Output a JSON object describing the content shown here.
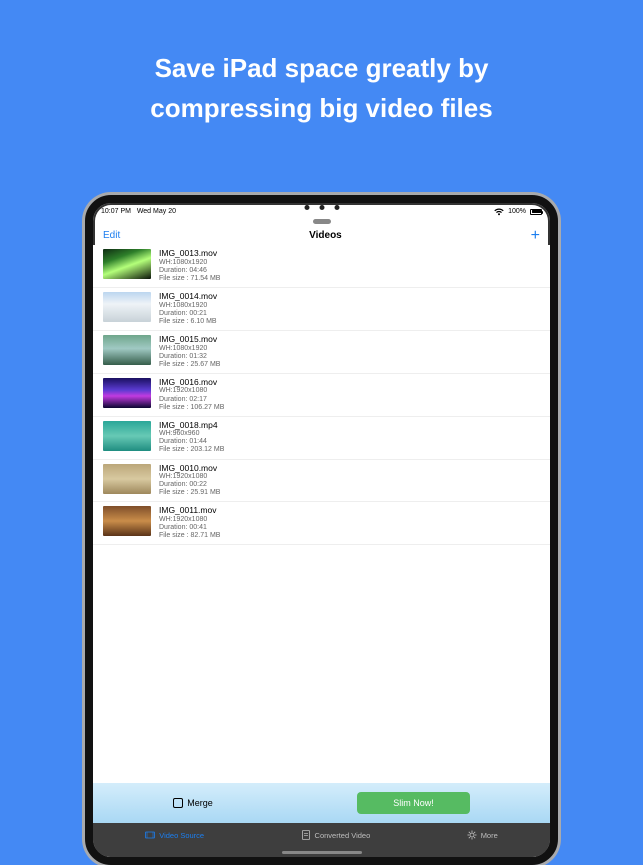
{
  "promo": {
    "line1": "Save iPad space  greatly by",
    "line2": "compressing big video files"
  },
  "statusbar": {
    "time": "10:07 PM",
    "date": "Wed May 20",
    "battery": "100%"
  },
  "nav": {
    "edit": "Edit",
    "title": "Videos",
    "add": "+"
  },
  "videos": [
    {
      "name": "IMG_0013.mov",
      "wh": "WH:1080x1920",
      "dur": "Duration: 04:46",
      "size": "File size : 71.54 MB",
      "t": "t0"
    },
    {
      "name": "IMG_0014.mov",
      "wh": "WH:1080x1920",
      "dur": "Duration: 00:21",
      "size": "File size : 6.10 MB",
      "t": "t1"
    },
    {
      "name": "IMG_0015.mov",
      "wh": "WH:1080x1920",
      "dur": "Duration: 01:32",
      "size": "File size : 25.67 MB",
      "t": "t2"
    },
    {
      "name": "IMG_0016.mov",
      "wh": "WH:1920x1080",
      "dur": "Duration: 02:17",
      "size": "File size : 106.27 MB",
      "t": "t3"
    },
    {
      "name": "IMG_0018.mp4",
      "wh": "WH:960x960",
      "dur": "Duration: 01:44",
      "size": "File size : 203.12 MB",
      "t": "t4"
    },
    {
      "name": "IMG_0010.mov",
      "wh": "WH:1920x1080",
      "dur": "Duration: 00:22",
      "size": "File size : 25.91 MB",
      "t": "t5"
    },
    {
      "name": "IMG_0011.mov",
      "wh": "WH:1920x1080",
      "dur": "Duration: 00:41",
      "size": "File size : 82.71 MB",
      "t": "t6"
    }
  ],
  "bottom": {
    "merge": "Merge",
    "slim": "Slim Now!"
  },
  "tabs": {
    "source": "Video Source",
    "converted": "Converted Video",
    "more": "More"
  }
}
